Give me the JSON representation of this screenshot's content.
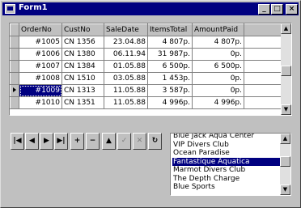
{
  "window": {
    "title": "Form1",
    "minimize": "_",
    "maximize": "□",
    "close": "×"
  },
  "grid": {
    "columns": [
      "OrderNo",
      "CustNo",
      "SaleDate",
      "ItemsTotal",
      "AmountPaid"
    ],
    "rows": [
      [
        "#1005",
        "CN 1356",
        "23.04.88",
        "4 807p.",
        "4 807p."
      ],
      [
        "#1006",
        "CN 1380",
        "06.11.94",
        "31 987p.",
        "0p."
      ],
      [
        "#1007",
        "CN 1384",
        "01.05.88",
        "6 500p.",
        "6 500p."
      ],
      [
        "#1008",
        "CN 1510",
        "03.05.88",
        "1 453p.",
        "0p."
      ],
      [
        "#1009",
        "CN 1313",
        "11.05.88",
        "3 587p.",
        "0p."
      ],
      [
        "#1010",
        "CN 1351",
        "11.05.88",
        "4 996p.",
        "4 996p."
      ]
    ],
    "current_row": 4,
    "selected_cell": "OrderNo"
  },
  "navigator": {
    "buttons": [
      {
        "name": "first",
        "glyph": "|◀",
        "enabled": true
      },
      {
        "name": "prior",
        "glyph": "◀",
        "enabled": true
      },
      {
        "name": "next",
        "glyph": "▶",
        "enabled": true
      },
      {
        "name": "last",
        "glyph": "▶|",
        "enabled": true
      },
      {
        "name": "insert",
        "glyph": "+",
        "enabled": true
      },
      {
        "name": "delete",
        "glyph": "−",
        "enabled": true
      },
      {
        "name": "edit",
        "glyph": "▲",
        "enabled": true
      },
      {
        "name": "post",
        "glyph": "✓",
        "enabled": false
      },
      {
        "name": "cancel",
        "glyph": "✕",
        "enabled": false
      },
      {
        "name": "refresh",
        "glyph": "↻",
        "enabled": true
      }
    ]
  },
  "listbox": {
    "items": [
      "Blue Jack Aqua Center",
      "VIP Divers Club",
      "Ocean Paradise",
      "Fantastique Aquatica",
      "Marmot Divers Club",
      "The Depth Charge",
      "Blue Sports"
    ],
    "selected_index": 3
  }
}
